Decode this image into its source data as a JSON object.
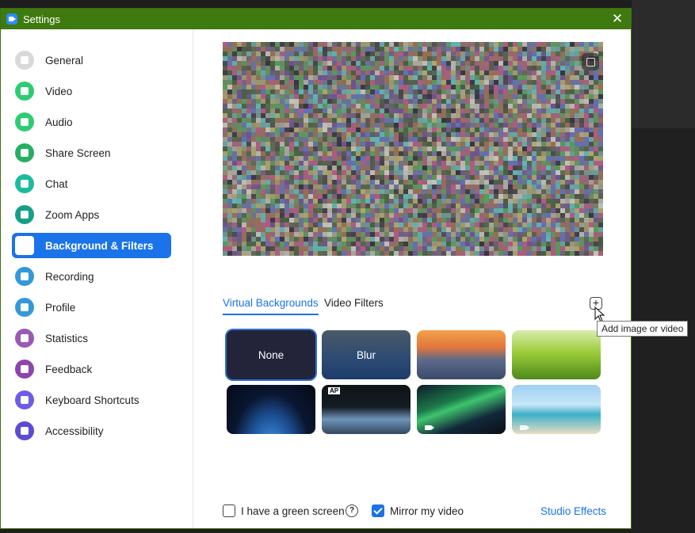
{
  "window": {
    "title": "Settings",
    "close_glyph": "✕"
  },
  "sidebar": {
    "items": [
      {
        "label": "General",
        "icon": "gear-icon",
        "color": "#d9d9d9",
        "active": false
      },
      {
        "label": "Video",
        "icon": "video-camera-icon",
        "color": "#2ecc71",
        "active": false
      },
      {
        "label": "Audio",
        "icon": "headphones-icon",
        "color": "#2ecc71",
        "active": false
      },
      {
        "label": "Share Screen",
        "icon": "share-screen-icon",
        "color": "#27ae60",
        "active": false
      },
      {
        "label": "Chat",
        "icon": "chat-bubble-icon",
        "color": "#1abc9c",
        "active": false
      },
      {
        "label": "Zoom Apps",
        "icon": "apps-icon",
        "color": "#16a085",
        "active": false
      },
      {
        "label": "Background & Filters",
        "icon": "background-person-icon",
        "color": "#1a73e8",
        "active": true
      },
      {
        "label": "Recording",
        "icon": "record-icon",
        "color": "#3498db",
        "active": false
      },
      {
        "label": "Profile",
        "icon": "profile-icon",
        "color": "#3498db",
        "active": false
      },
      {
        "label": "Statistics",
        "icon": "bar-chart-icon",
        "color": "#9b59b6",
        "active": false
      },
      {
        "label": "Feedback",
        "icon": "smiley-icon",
        "color": "#8e44ad",
        "active": false
      },
      {
        "label": "Keyboard Shortcuts",
        "icon": "keyboard-icon",
        "color": "#6c5ce7",
        "active": false
      },
      {
        "label": "Accessibility",
        "icon": "accessibility-icon",
        "color": "#5b4bd6",
        "active": false
      }
    ]
  },
  "main": {
    "tabs": [
      {
        "label": "Virtual Backgrounds",
        "active": true
      },
      {
        "label": "Video Filters",
        "active": false
      }
    ],
    "add_button_glyph": "+",
    "tooltip": "Add image or video",
    "backgrounds": [
      {
        "label": "None",
        "kind": "none",
        "selected": true,
        "video": false
      },
      {
        "label": "Blur",
        "kind": "blur",
        "selected": false,
        "video": false
      },
      {
        "label": "",
        "kind": "golden-gate",
        "selected": false,
        "video": false
      },
      {
        "label": "",
        "kind": "grass",
        "selected": false,
        "video": false
      },
      {
        "label": "",
        "kind": "earth-space",
        "selected": false,
        "video": false
      },
      {
        "label": "AP",
        "kind": "earth-news",
        "selected": false,
        "video": false
      },
      {
        "label": "",
        "kind": "aurora",
        "selected": false,
        "video": true
      },
      {
        "label": "",
        "kind": "beach",
        "selected": false,
        "video": true
      }
    ],
    "green_screen": {
      "label": "I have a green screen",
      "checked": false
    },
    "help_glyph": "?",
    "mirror": {
      "label": "Mirror my video",
      "checked": true
    },
    "studio_effects": "Studio Effects"
  },
  "colors": {
    "titlebar": "#3f7a10",
    "accent": "#1a73e8"
  }
}
